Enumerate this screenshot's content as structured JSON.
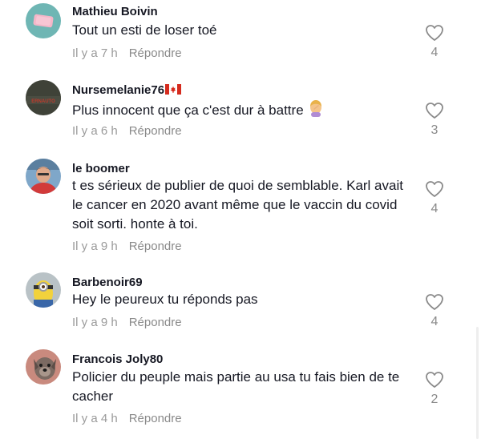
{
  "comments": [
    {
      "username": "Mathieu Boivin",
      "text": "Tout un esti de loser toé",
      "time": "Il y a 7 h",
      "reply": "Répondre",
      "likes": "4",
      "avatar_icon": "pink-eraser-avatar"
    },
    {
      "username": "Nursemelanie76",
      "flag": "canada-flag-icon",
      "text": "Plus innocent que ça c'est dur à battre",
      "emoji": "person-facepalming-emoji",
      "time": "Il y a 6 h",
      "reply": "Répondre",
      "likes": "3",
      "avatar_icon": "dark-shirt-avatar"
    },
    {
      "username": "le boomer",
      "text": "t es sérieux de publier de quoi de semblable. Karl avait le cancer en 2020 avant même que le vaccin du covid soit sorti. honte à toi.",
      "time": "Il y a 9 h",
      "reply": "Répondre",
      "likes": "4",
      "avatar_icon": "man-red-shirt-avatar"
    },
    {
      "username": "Barbenoir69",
      "text": "Hey le peureux tu réponds pas",
      "time": "Il y a 9 h",
      "reply": "Répondre",
      "likes": "4",
      "avatar_icon": "minion-avatar"
    },
    {
      "username": "Francois Joly80",
      "text": "Policier du peuple mais partie au usa tu fais bien de te cacher",
      "time": "Il y a 4 h",
      "reply": "Répondre",
      "likes": "2",
      "avatar_icon": "dog-avatar"
    }
  ],
  "colors": {
    "text": "#161823",
    "meta": "#9a9a9a",
    "icon": "#8a8a8a"
  }
}
